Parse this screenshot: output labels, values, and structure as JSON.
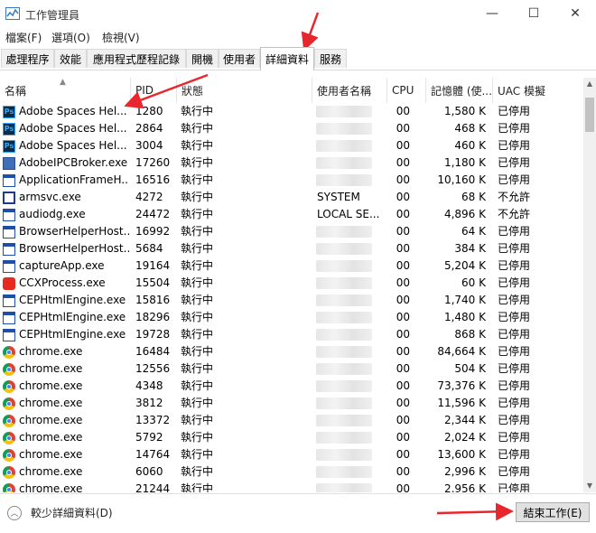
{
  "window": {
    "title": "工作管理員",
    "minimize": "—",
    "maximize": "☐",
    "close": "✕"
  },
  "menu": [
    "檔案(F)",
    "選項(O)",
    "檢視(V)"
  ],
  "tabs": [
    "處理程序",
    "效能",
    "應用程式歷程記錄",
    "開機",
    "使用者",
    "詳細資料",
    "服務"
  ],
  "active_tab": "詳細資料",
  "columns": {
    "name": "名稱",
    "pid": "PID",
    "status": "狀態",
    "user": "使用者名稱",
    "cpu": "CPU",
    "memory": "記憶體 (使...",
    "uac": "UAC 模擬"
  },
  "rows": [
    {
      "icon": "photoshop-icon",
      "name": "Adobe Spaces Hel...",
      "pid": "1280",
      "status": "執行中",
      "user": "",
      "cpu": "00",
      "mem": "1,580 K",
      "uac": "已停用"
    },
    {
      "icon": "photoshop-icon",
      "name": "Adobe Spaces Hel...",
      "pid": "2864",
      "status": "執行中",
      "user": "",
      "cpu": "00",
      "mem": "468 K",
      "uac": "已停用"
    },
    {
      "icon": "photoshop-icon",
      "name": "Adobe Spaces Hel...",
      "pid": "3004",
      "status": "執行中",
      "user": "",
      "cpu": "00",
      "mem": "460 K",
      "uac": "已停用"
    },
    {
      "icon": "app-icon",
      "name": "AdobeIPCBroker.exe",
      "pid": "17260",
      "status": "執行中",
      "user": "",
      "cpu": "00",
      "mem": "1,180 K",
      "uac": "已停用"
    },
    {
      "icon": "window-icon",
      "name": "ApplicationFrameH...",
      "pid": "16516",
      "status": "執行中",
      "user": "",
      "cpu": "00",
      "mem": "10,160 K",
      "uac": "已停用"
    },
    {
      "icon": "service-icon",
      "name": "armsvc.exe",
      "pid": "4272",
      "status": "執行中",
      "user": "SYSTEM",
      "cpu": "00",
      "mem": "68 K",
      "uac": "不允許"
    },
    {
      "icon": "window-icon",
      "name": "audiodg.exe",
      "pid": "24472",
      "status": "執行中",
      "user": "LOCAL SE...",
      "cpu": "00",
      "mem": "4,896 K",
      "uac": "不允許"
    },
    {
      "icon": "window-icon",
      "name": "BrowserHelperHost...",
      "pid": "16992",
      "status": "執行中",
      "user": "",
      "cpu": "00",
      "mem": "64 K",
      "uac": "已停用"
    },
    {
      "icon": "window-icon",
      "name": "BrowserHelperHost...",
      "pid": "5684",
      "status": "執行中",
      "user": "",
      "cpu": "00",
      "mem": "384 K",
      "uac": "已停用"
    },
    {
      "icon": "window-icon",
      "name": "captureApp.exe",
      "pid": "19164",
      "status": "執行中",
      "user": "",
      "cpu": "00",
      "mem": "5,204 K",
      "uac": "已停用"
    },
    {
      "icon": "creative-cloud-icon",
      "name": "CCXProcess.exe",
      "pid": "15504",
      "status": "執行中",
      "user": "",
      "cpu": "00",
      "mem": "60 K",
      "uac": "已停用"
    },
    {
      "icon": "window-icon",
      "name": "CEPHtmlEngine.exe",
      "pid": "15816",
      "status": "執行中",
      "user": "",
      "cpu": "00",
      "mem": "1,740 K",
      "uac": "已停用"
    },
    {
      "icon": "window-icon",
      "name": "CEPHtmlEngine.exe",
      "pid": "18296",
      "status": "執行中",
      "user": "",
      "cpu": "00",
      "mem": "1,480 K",
      "uac": "已停用"
    },
    {
      "icon": "window-icon",
      "name": "CEPHtmlEngine.exe",
      "pid": "19728",
      "status": "執行中",
      "user": "",
      "cpu": "00",
      "mem": "868 K",
      "uac": "已停用"
    },
    {
      "icon": "chrome-icon",
      "name": "chrome.exe",
      "pid": "16484",
      "status": "執行中",
      "user": "",
      "cpu": "00",
      "mem": "84,664 K",
      "uac": "已停用"
    },
    {
      "icon": "chrome-icon",
      "name": "chrome.exe",
      "pid": "12556",
      "status": "執行中",
      "user": "",
      "cpu": "00",
      "mem": "504 K",
      "uac": "已停用"
    },
    {
      "icon": "chrome-icon",
      "name": "chrome.exe",
      "pid": "4348",
      "status": "執行中",
      "user": "",
      "cpu": "00",
      "mem": "73,376 K",
      "uac": "已停用"
    },
    {
      "icon": "chrome-icon",
      "name": "chrome.exe",
      "pid": "3812",
      "status": "執行中",
      "user": "",
      "cpu": "00",
      "mem": "11,596 K",
      "uac": "已停用"
    },
    {
      "icon": "chrome-icon",
      "name": "chrome.exe",
      "pid": "13372",
      "status": "執行中",
      "user": "",
      "cpu": "00",
      "mem": "2,344 K",
      "uac": "已停用"
    },
    {
      "icon": "chrome-icon",
      "name": "chrome.exe",
      "pid": "5792",
      "status": "執行中",
      "user": "",
      "cpu": "00",
      "mem": "2,024 K",
      "uac": "已停用"
    },
    {
      "icon": "chrome-icon",
      "name": "chrome.exe",
      "pid": "14764",
      "status": "執行中",
      "user": "",
      "cpu": "00",
      "mem": "13,600 K",
      "uac": "已停用"
    },
    {
      "icon": "chrome-icon",
      "name": "chrome.exe",
      "pid": "6060",
      "status": "執行中",
      "user": "",
      "cpu": "00",
      "mem": "2,996 K",
      "uac": "已停用"
    },
    {
      "icon": "chrome-icon",
      "name": "chrome.exe",
      "pid": "21244",
      "status": "執行中",
      "user": "",
      "cpu": "00",
      "mem": "2,956 K",
      "uac": "已停用"
    }
  ],
  "footer": {
    "fewer_details": "較少詳細資料(D)",
    "end_task": "結束工作(E)"
  },
  "colors": {
    "annotation_arrow": "#e8262d",
    "scroll_thumb": "#c2c2c2"
  }
}
